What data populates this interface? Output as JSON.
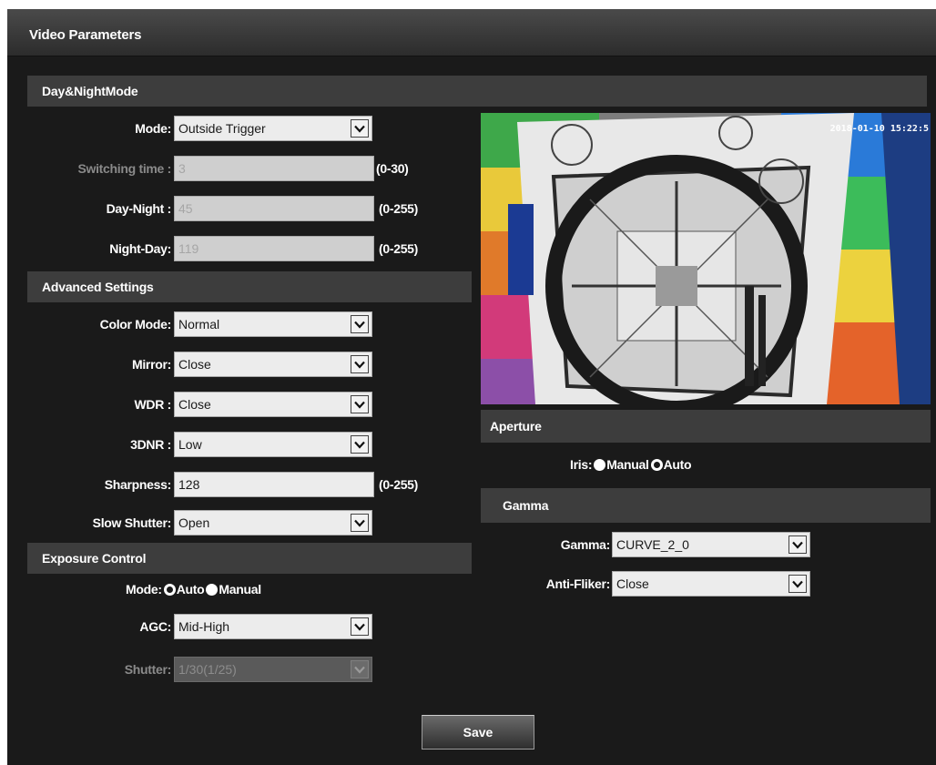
{
  "title": "Video Parameters",
  "day_night": {
    "header": "Day&NightMode",
    "mode_label": "Mode:",
    "mode_value": "Outside Trigger",
    "switching_label": "Switching time :",
    "switching_value": "3",
    "switching_range": "(0-30)",
    "day_night_label": "Day-Night :",
    "day_night_value": "45",
    "day_night_range": "(0-255)",
    "night_day_label": "Night-Day:",
    "night_day_value": "119",
    "night_day_range": "(0-255)"
  },
  "advanced": {
    "header": "Advanced Settings",
    "color_mode_label": "Color Mode:",
    "color_mode_value": "Normal",
    "mirror_label": "Mirror:",
    "mirror_value": "Close",
    "wdr_label": "WDR :",
    "wdr_value": "Close",
    "dnr_label": "3DNR :",
    "dnr_value": "Low",
    "sharpness_label": "Sharpness:",
    "sharpness_value": "128",
    "sharpness_range": "(0-255)",
    "slow_shutter_label": "Slow Shutter:",
    "slow_shutter_value": "Open"
  },
  "exposure": {
    "header": "Exposure Control",
    "mode_label": "Mode:",
    "mode_options": [
      "Auto",
      "Manual"
    ],
    "mode_selected": "Auto",
    "agc_label": "AGC:",
    "agc_value": "Mid-High",
    "shutter_label": "Shutter:",
    "shutter_value": "1/30(1/25)"
  },
  "preview": {
    "timestamp": "2018-01-10 15:22:5"
  },
  "aperture": {
    "header": "Aperture",
    "iris_label": "Iris:",
    "iris_options": [
      "Manual",
      "Auto"
    ],
    "iris_selected": "Auto"
  },
  "gamma": {
    "header": "Gamma",
    "gamma_label": "Gamma:",
    "gamma_value": "CURVE_2_0",
    "antiflicker_label": "Anti-Fliker:",
    "antiflicker_value": "Close"
  },
  "save_label": "Save",
  "icons": {
    "dropdown": "chevron-down-icon",
    "radio_selected": "radio-selected-icon",
    "radio_unselected": "radio-unselected-icon"
  },
  "colors": {
    "background": "#1a1a1a",
    "section_bar": "#3d3d3d",
    "text": "#ffffff"
  }
}
